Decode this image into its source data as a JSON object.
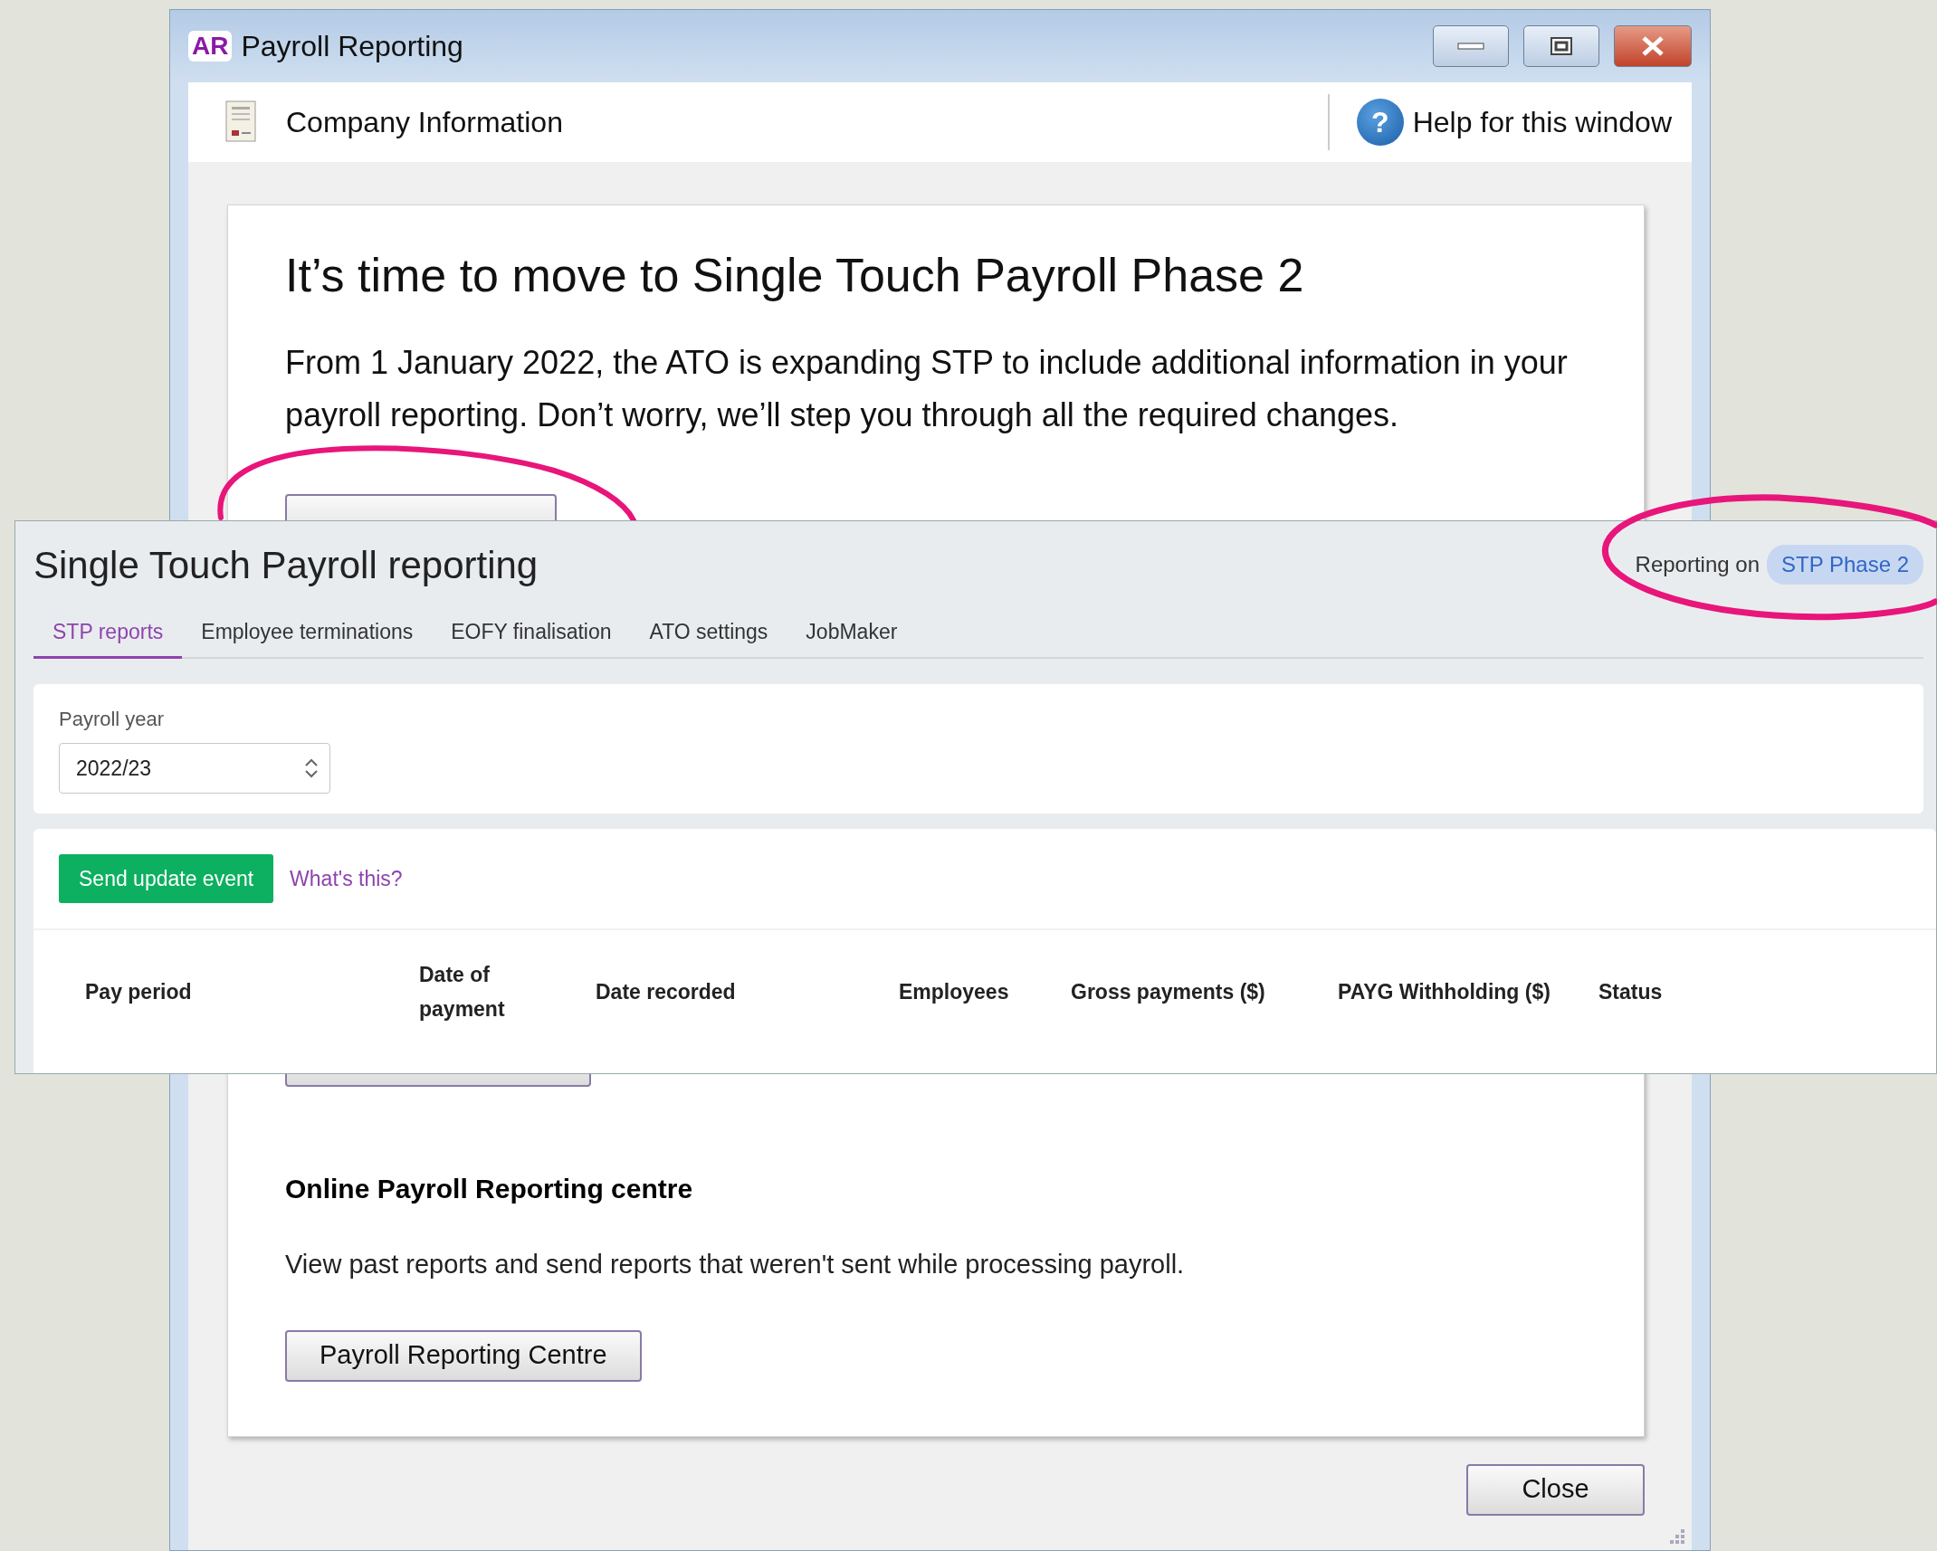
{
  "window": {
    "app_badge": "AR",
    "title": "Payroll Reporting"
  },
  "toolbar": {
    "items": [
      {
        "label": "Company Information"
      }
    ],
    "help_glyph": "?",
    "help": "Help for this window"
  },
  "card": {
    "heading": "It’s time to move to Single Touch Payroll Phase 2",
    "body": "From 1 January 2022, the ATO is expanding STP to include additional information in your payroll reporting. Don’t worry, we’ll step you through all the required changes.",
    "section_title": "Online Payroll Reporting centre",
    "section_text": "View past reports and send reports that weren't sent while processing payroll.",
    "section_button": "Payroll Reporting Centre"
  },
  "footer_buttons": [
    "Close"
  ],
  "overlay": {
    "title": "Single Touch Payroll reporting",
    "reporting_label": "Reporting on",
    "reporting_badge": "STP Phase 2",
    "tabs": [
      {
        "label": "STP reports",
        "selected": true
      },
      {
        "label": "Employee terminations",
        "selected": false
      },
      {
        "label": "EOFY finalisation",
        "selected": false
      },
      {
        "label": "ATO settings",
        "selected": false
      },
      {
        "label": "JobMaker",
        "selected": false
      }
    ],
    "payroll_year": {
      "label": "Payroll year",
      "value": "2022/23"
    },
    "actions": {
      "button": "Send update event",
      "link": "What's this?"
    },
    "table": {
      "columns": [
        "Pay period",
        "Date of payment",
        "Date recorded",
        "Employees",
        "Gross payments ($)",
        "PAYG Withholding ($)",
        "Status"
      ]
    }
  }
}
